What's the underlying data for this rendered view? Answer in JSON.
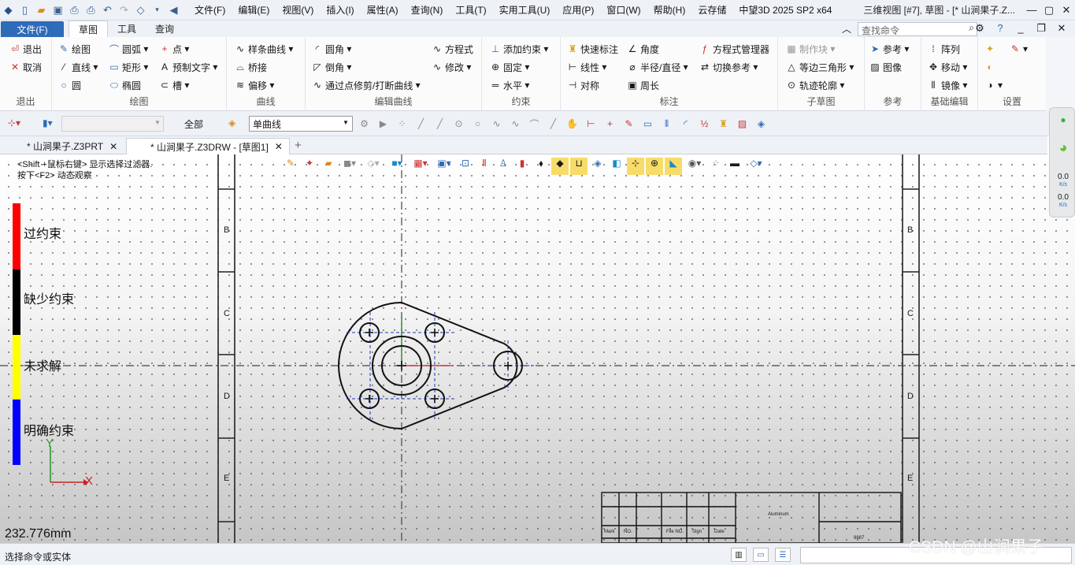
{
  "titlebar": {
    "quick_icons": [
      "app-logo-icon",
      "new-file-icon",
      "open-folder-icon",
      "save-icon",
      "print-icon",
      "print-preview-icon",
      "undo-icon",
      "redo-icon",
      "select-filter-icon",
      "dropdown-arrow-icon",
      "nav-left-icon"
    ],
    "menus": [
      "文件(F)",
      "编辑(E)",
      "视图(V)",
      "插入(I)",
      "属性(A)",
      "查询(N)",
      "工具(T)",
      "实用工具(U)",
      "应用(P)",
      "窗口(W)",
      "帮助(H)",
      "云存储"
    ],
    "app_version": "中望3D 2025 SP2 x64",
    "window_title": "三维视图 [#7], 草图 - [* 山涧果子.Z..."
  },
  "ribbon_tabs": {
    "file": "文件(F)",
    "tabs": [
      "草图",
      "工具",
      "查询"
    ],
    "active": "草图",
    "search_placeholder": "查找命令"
  },
  "ribbon": {
    "exit": {
      "items": [
        "退出",
        "取消"
      ],
      "label": "退出"
    },
    "draw": {
      "items": [
        "绘图",
        "直线",
        "圆",
        "圆弧",
        "矩形",
        "椭圆",
        "点",
        "预制文字",
        "槽"
      ],
      "label": "绘图"
    },
    "curve": {
      "items": [
        "样条曲线",
        "桥接",
        "偏移"
      ],
      "label": "曲线"
    },
    "edit_curve": {
      "items": [
        "圆角",
        "倒角",
        "通过点修剪/打断曲线",
        "方程式",
        "修改"
      ],
      "label": "编辑曲线"
    },
    "constraint": {
      "items": [
        "添加约束",
        "固定",
        "水平"
      ],
      "label": "约束"
    },
    "annotation": {
      "items": [
        "快速标注",
        "线性",
        "对称",
        "角度",
        "半径/直径",
        "周长",
        "方程式管理器",
        "切换参考"
      ],
      "label": "标注"
    },
    "subsketch": {
      "items": [
        "制作块",
        "等边三角形",
        "轨迹轮廓"
      ],
      "label": "子草图"
    },
    "reference": {
      "items": [
        "参考",
        "图像"
      ],
      "label": "参考"
    },
    "basic_edit": {
      "items": [
        "阵列",
        "移动",
        "镜像"
      ],
      "label": "基础编辑"
    },
    "settings": {
      "label": "设置"
    }
  },
  "toolbar2": {
    "all_label": "全部",
    "curve_type": "单曲线"
  },
  "doc_tabs": [
    "* 山涧果子.Z3PRT",
    "* 山涧果子.Z3DRW - [草图1]"
  ],
  "canvas": {
    "hint_line1": "<Shift +鼠标右键> 显示选择过滤器.",
    "hint_line2": "按下<F2> 动态观察",
    "legend": [
      {
        "label": "过约束",
        "color": "#ff0000"
      },
      {
        "label": "缺少约束",
        "color": "#000000"
      },
      {
        "label": "未求解",
        "color": "#ffff00"
      },
      {
        "label": "明确约束",
        "color": "#0000ff"
      }
    ],
    "axis_y": "Y",
    "axis_x": "X",
    "distance": "232.776mm",
    "zone_letters": [
      "B",
      "C",
      "D",
      "E"
    ],
    "title_block": {
      "company": "Aluminum",
      "headers": [
        "Mark",
        "NO.",
        "File NO.",
        "Sign",
        "Date"
      ],
      "code": "8887"
    }
  },
  "side_panel": {
    "value1": "0.0",
    "value2": "0.0",
    "unit": "K/s"
  },
  "status": {
    "text": "选择命令或实体"
  },
  "watermark": "CSDN @山涧果子"
}
